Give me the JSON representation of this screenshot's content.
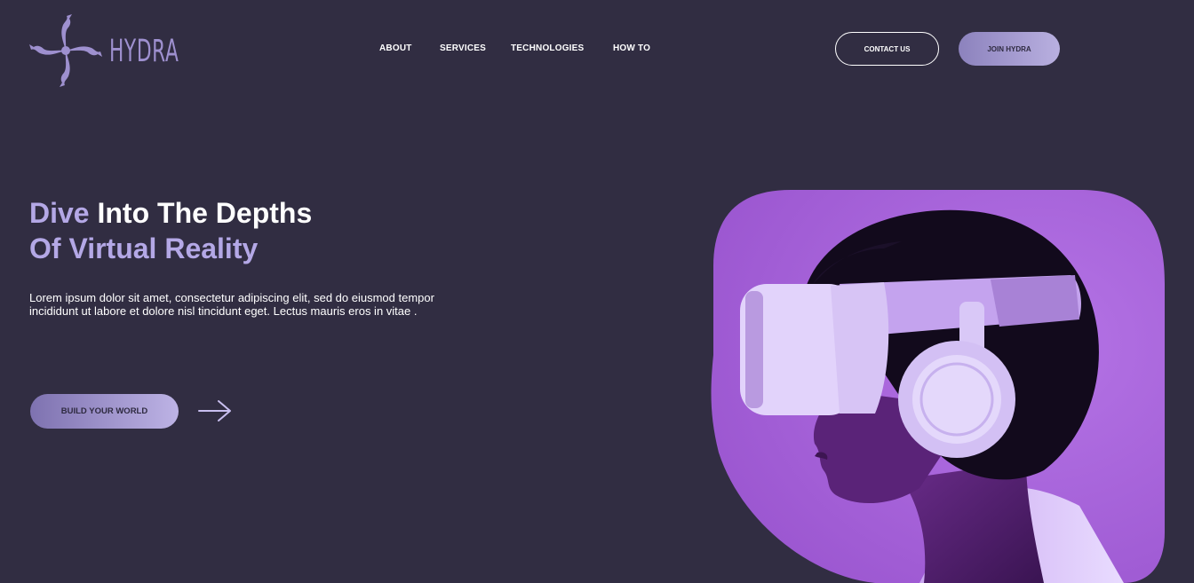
{
  "brand": {
    "name": "HYDRA",
    "logo_icon": "hydra-swirl-icon",
    "accent_color": "#9e90cf"
  },
  "nav": {
    "items": [
      {
        "label": "ABOUT"
      },
      {
        "label": "SERVICES"
      },
      {
        "label": "TECHNOLOGIES"
      },
      {
        "label": "HOW TO"
      }
    ]
  },
  "header_actions": {
    "contact_label": "CONTACT US",
    "join_label": "JOIN HYDRA"
  },
  "hero": {
    "headline_word1": "Dive",
    "headline_rest1": " Into The Depths",
    "headline_line2": "Of Virtual Reality",
    "description": "Lorem ipsum dolor sit amet, consectetur adipiscing elit, sed do eiusmod tempor incididunt ut labore et dolore nisl tincidunt eget. Lectus mauris eros in vitae .",
    "cta_label": "BUILD YOUR WORLD",
    "cta_icon": "arrow-right-icon",
    "image_icon": "vr-headset-person-image"
  },
  "colors": {
    "background": "#312d42",
    "accent_text": "#b4a8e6",
    "image_bg": "#a862d8"
  }
}
